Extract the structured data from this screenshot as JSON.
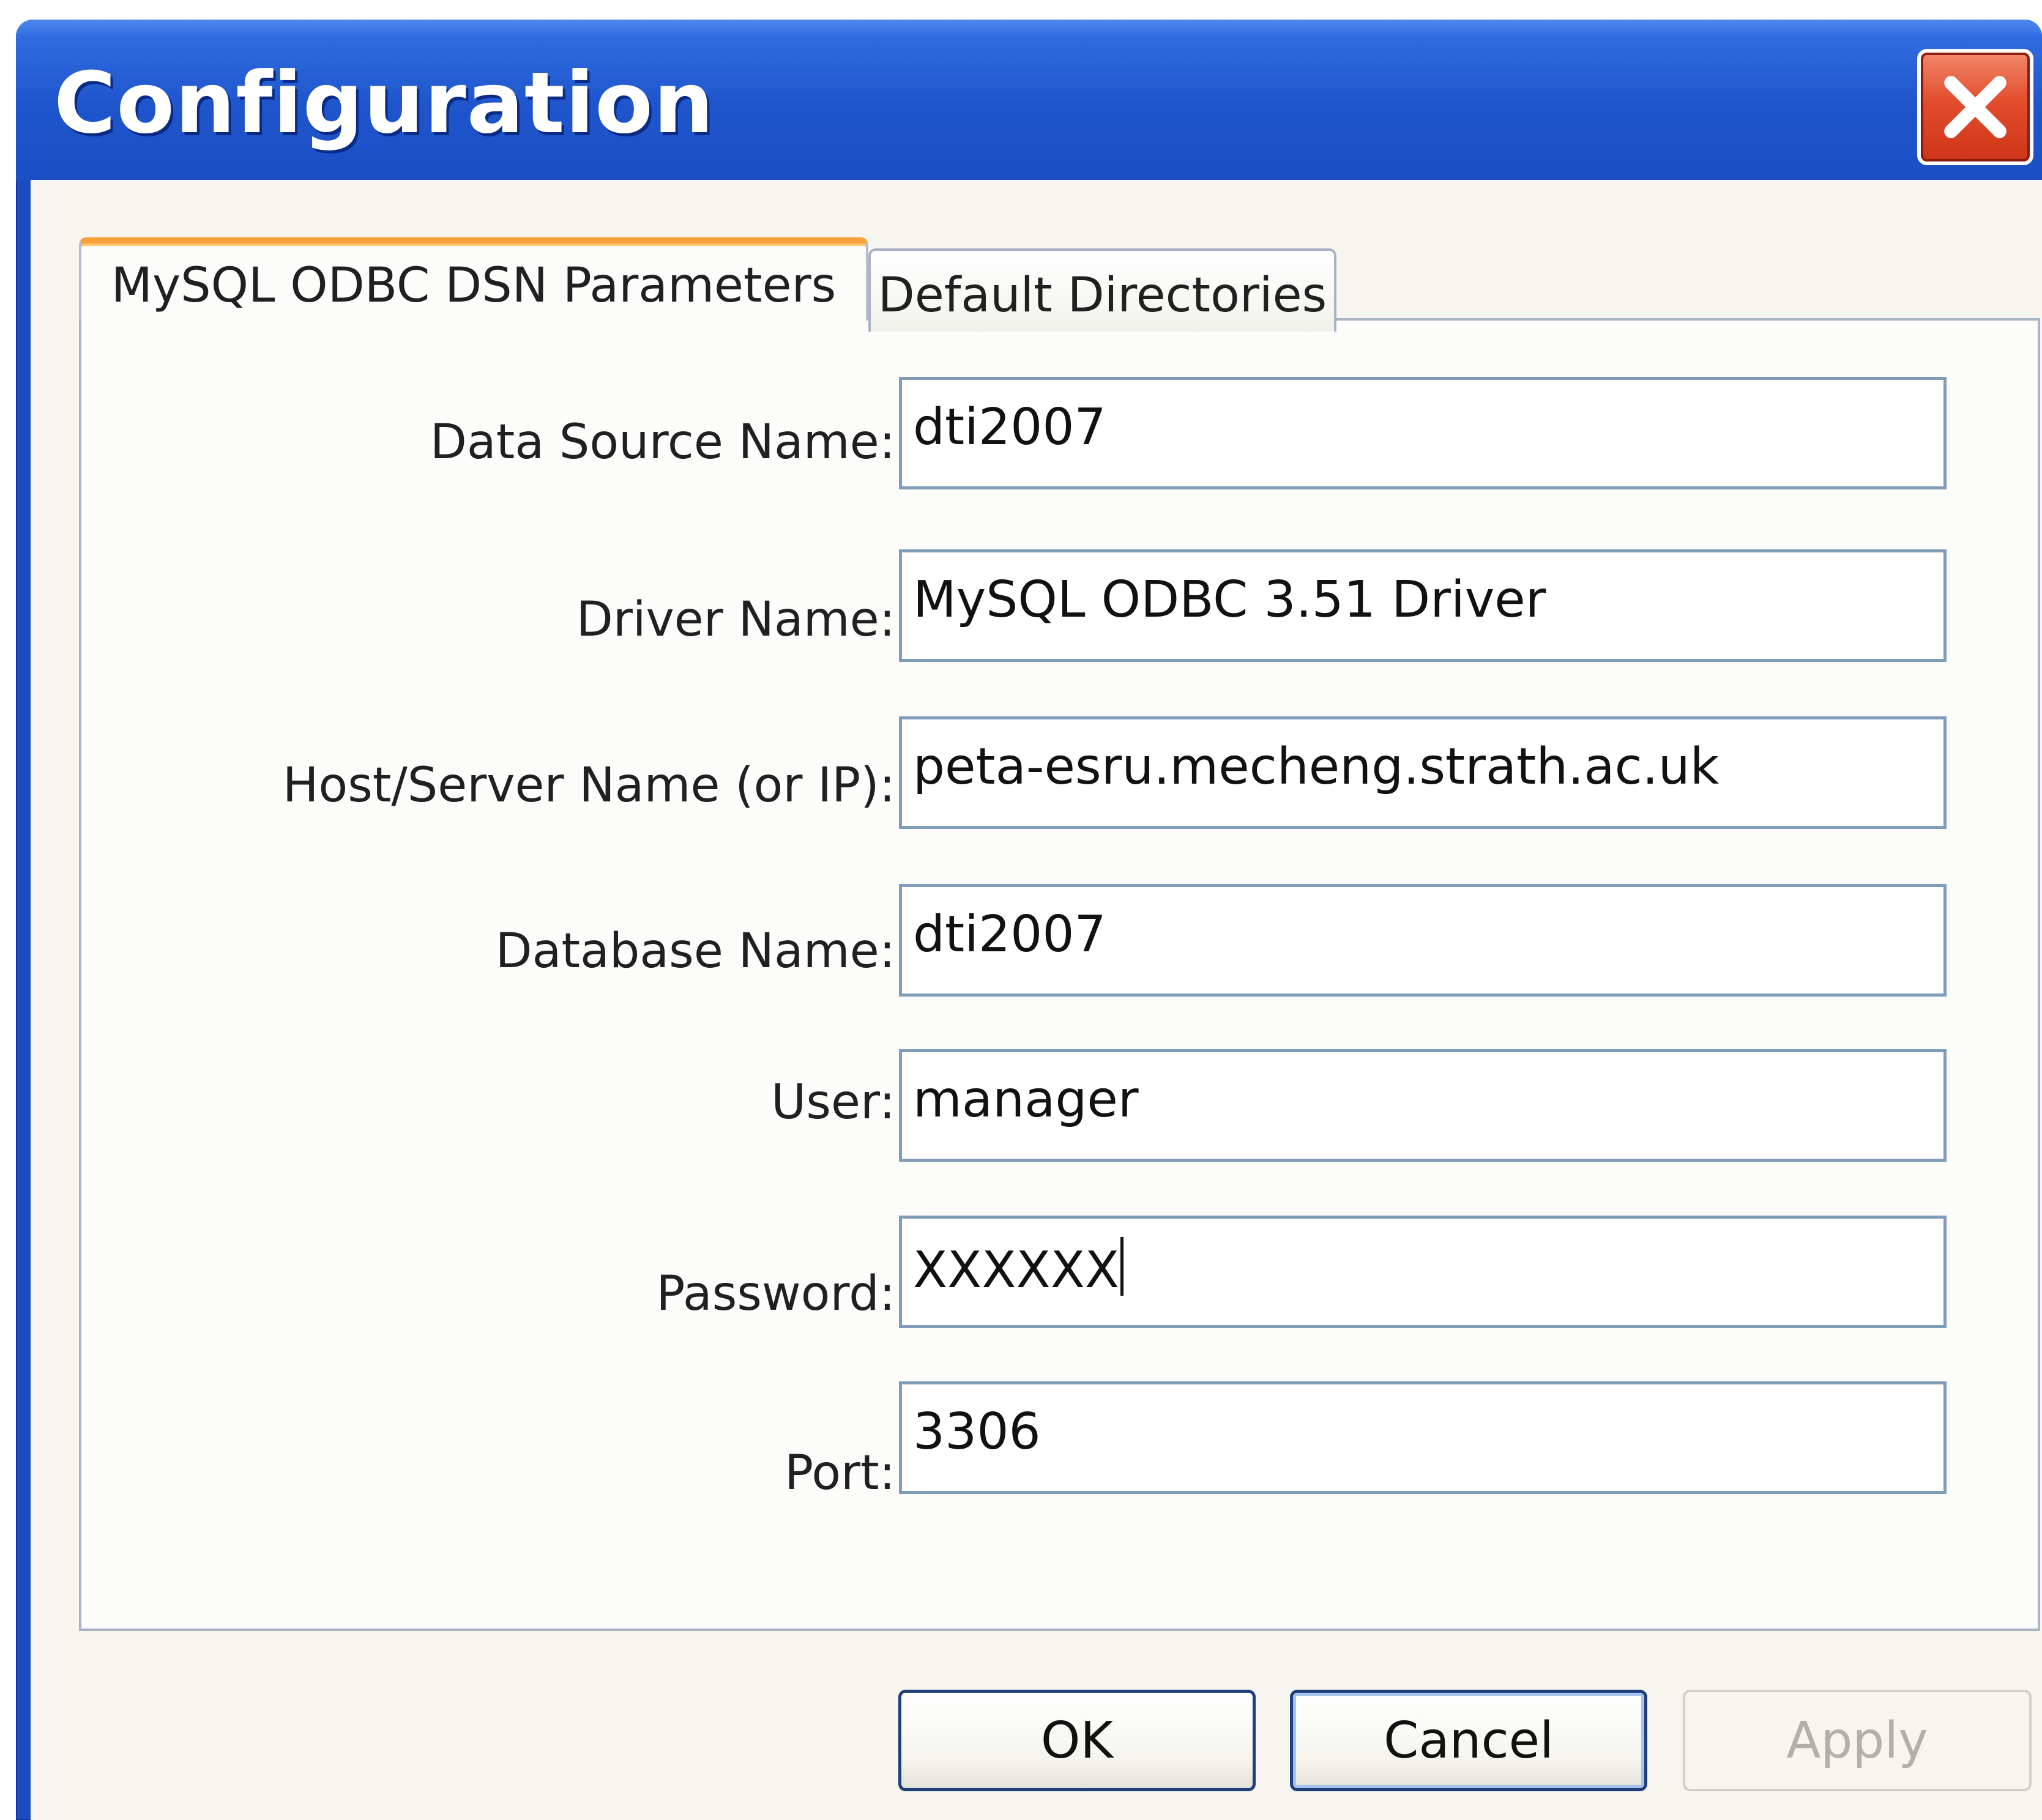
{
  "window": {
    "title": "Configuration"
  },
  "tabs": [
    {
      "label": "MySQL ODBC DSN Parameters",
      "active": true
    },
    {
      "label": "Default Directories",
      "active": false
    }
  ],
  "form": {
    "fields": [
      {
        "label": "Data Source Name:",
        "value": "dti2007"
      },
      {
        "label": "Driver Name:",
        "value": "MySQL ODBC 3.51 Driver"
      },
      {
        "label": "Host/Server Name (or IP):",
        "value": "peta-esru.mecheng.strath.ac.uk"
      },
      {
        "label": "Database Name:",
        "value": "dti2007"
      },
      {
        "label": "User:",
        "value": "manager"
      },
      {
        "label": "Password:",
        "value": "XXXXXX"
      },
      {
        "label": "Port:",
        "value": "3306"
      }
    ]
  },
  "buttons": {
    "ok": "OK",
    "cancel": "Cancel",
    "apply": "Apply"
  },
  "colors": {
    "titlebar": "#1f55cc",
    "active_tab_accent": "#f7a13a",
    "close_button": "#e14d2d",
    "field_border": "#7f9db9"
  },
  "icons": {
    "close": "close-icon"
  }
}
